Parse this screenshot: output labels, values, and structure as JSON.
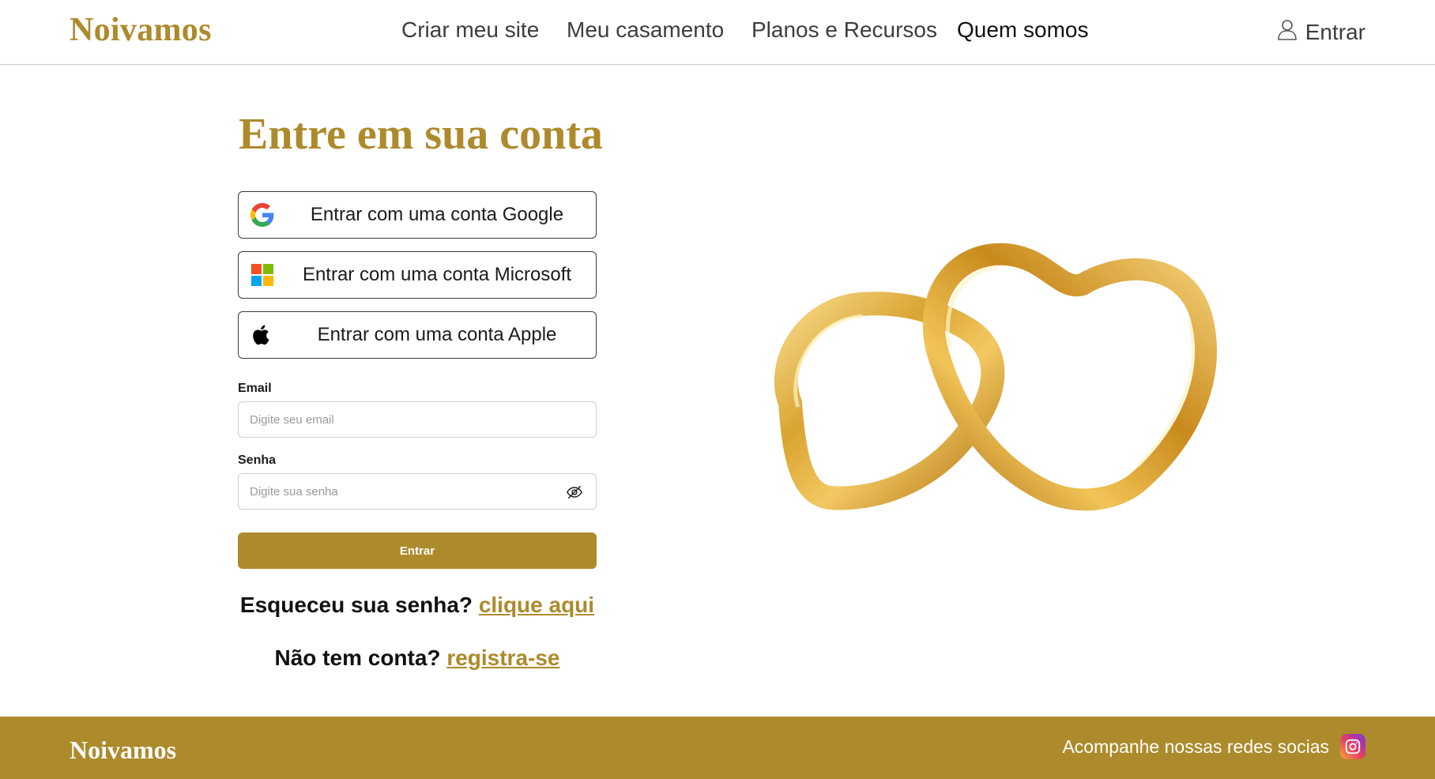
{
  "header": {
    "logo": "Noivamos",
    "nav": [
      {
        "label": "Criar meu site"
      },
      {
        "label": "Meu casamento"
      },
      {
        "label": "Planos e Recursos"
      },
      {
        "label": "Quem somos"
      }
    ],
    "login_label": "Entrar"
  },
  "login": {
    "title": "Entre em sua conta",
    "google_label": "Entrar com uma conta Google",
    "microsoft_label": "Entrar com uma conta Microsoft",
    "apple_label": "Entrar com uma conta Apple",
    "email_label": "Email",
    "email_placeholder": "Digite seu email",
    "email_value": "",
    "password_label": "Senha",
    "password_placeholder": "Digite sua senha",
    "password_value": "",
    "submit_label": "Entrar",
    "forgot_text": "Esqueceu sua senha?",
    "forgot_link": "clique aqui",
    "register_text": "Não tem conta?",
    "register_link": "registra-se"
  },
  "footer": {
    "logo": "Noivamos",
    "social_text": "Acompanhe nossas redes socias"
  },
  "icons": {
    "user": "user-icon",
    "google": "google-icon",
    "microsoft": "microsoft-icon",
    "apple": "apple-icon",
    "eye_off": "eye-off-icon",
    "instagram": "instagram-icon"
  },
  "colors": {
    "brand_gold": "#ad8a2b",
    "text_dark": "#1b1b1b",
    "border": "#3a3a3a"
  }
}
